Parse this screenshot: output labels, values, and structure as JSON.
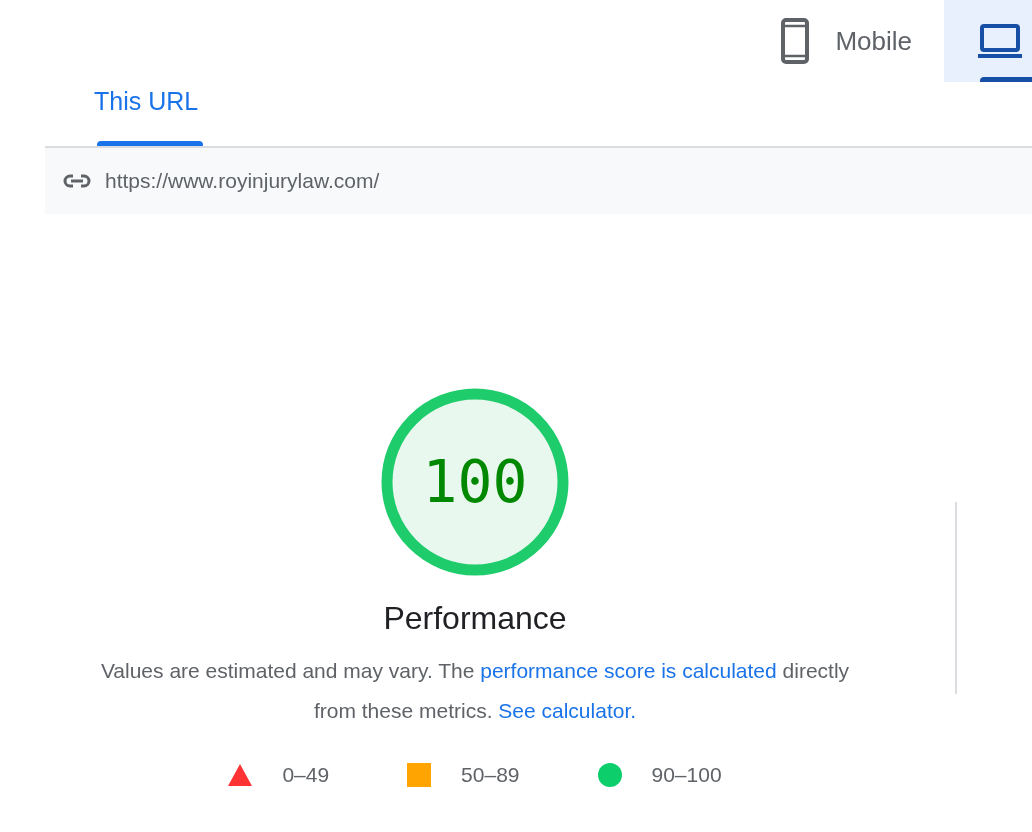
{
  "device_tabs": [
    {
      "kind": "mobile",
      "label": "Mobile",
      "selected": false
    },
    {
      "kind": "desktop",
      "selected": true
    }
  ],
  "url_tabs": [
    {
      "label": "This URL",
      "selected": true
    }
  ],
  "url": "https://www.royinjurylaw.com/",
  "gauge": {
    "score": "100",
    "level": 1,
    "title": "Performance"
  },
  "description": [
    {
      "kind": "text",
      "text": "Values are estimated and may vary. The "
    },
    {
      "kind": "link",
      "text": "performance score is calculated"
    },
    {
      "kind": "text",
      "text": " directly from these metrics. "
    },
    {
      "kind": "link",
      "text": "See calculator."
    }
  ],
  "legend": [
    {
      "kind": "triangle",
      "range": "0–49",
      "color": "#ff3333"
    },
    {
      "kind": "square",
      "range": "50–89",
      "color": "#ffa400"
    },
    {
      "kind": "circle",
      "range": "90–100",
      "color": "#0cce6b"
    }
  ]
}
